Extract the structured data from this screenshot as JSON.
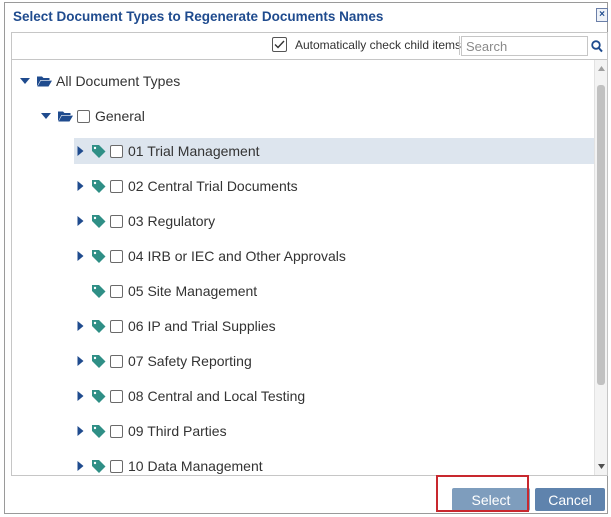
{
  "dialog": {
    "title": "Select Document Types to Regenerate Documents Names",
    "close_glyph": "×"
  },
  "toolbar": {
    "auto_check_label": "Automatically check child items",
    "auto_check_checked": true,
    "search_placeholder": "Search",
    "search_value": ""
  },
  "tree": {
    "root": {
      "label": "All Document Types",
      "expanded": true
    },
    "group": {
      "label": "General",
      "expanded": true,
      "checked": false
    },
    "items": [
      {
        "label": "01 Trial Management",
        "has_children": true,
        "checked": false,
        "selected": true
      },
      {
        "label": "02 Central Trial Documents",
        "has_children": true,
        "checked": false
      },
      {
        "label": "03 Regulatory",
        "has_children": true,
        "checked": false
      },
      {
        "label": "04 IRB or IEC and Other Approvals",
        "has_children": true,
        "checked": false
      },
      {
        "label": "05 Site Management",
        "has_children": false,
        "checked": false
      },
      {
        "label": "06 IP and Trial Supplies",
        "has_children": true,
        "checked": false
      },
      {
        "label": "07 Safety Reporting",
        "has_children": true,
        "checked": false
      },
      {
        "label": "08 Central and Local Testing",
        "has_children": true,
        "checked": false
      },
      {
        "label": "09 Third Parties",
        "has_children": true,
        "checked": false
      },
      {
        "label": "10 Data Management",
        "has_children": true,
        "checked": false
      }
    ]
  },
  "footer": {
    "select_label": "Select",
    "cancel_label": "Cancel"
  },
  "colors": {
    "title": "#1f4b8e",
    "tag_icon": "#2f8f86",
    "folder_icon": "#1f4b8e",
    "selected_row": "#dde5ee",
    "select_button": "#7e9dbd",
    "cancel_button": "#5f83ad",
    "highlight_box": "#c8282e"
  }
}
